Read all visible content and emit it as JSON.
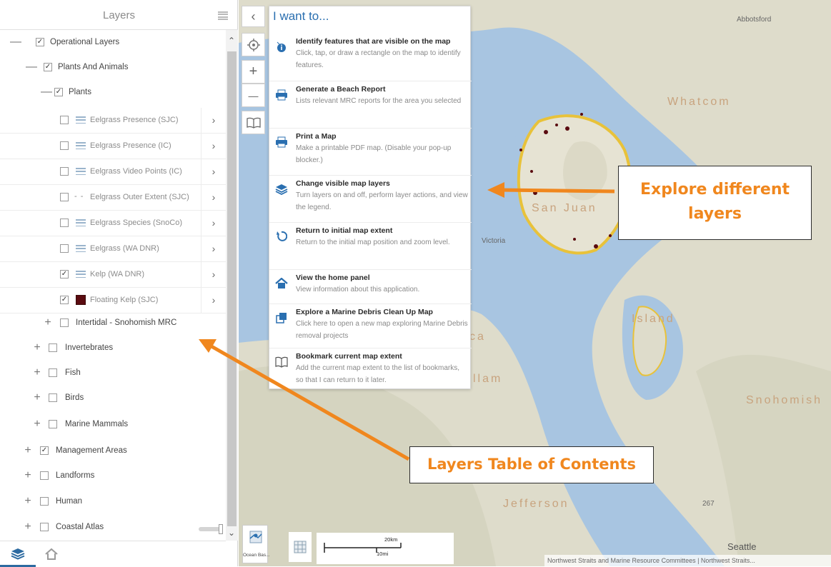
{
  "panel": {
    "title": "Layers",
    "rows": [
      {
        "label": "Operational Layers",
        "expander": "—",
        "checked": true
      },
      {
        "label": "Plants And Animals",
        "expander": "—",
        "checked": true
      },
      {
        "label": "Plants",
        "expander": "—",
        "checked": true
      },
      {
        "label": "Eelgrass Presence (SJC)",
        "checked": false,
        "legend": "lines"
      },
      {
        "label": "Eelgrass Presence (IC)",
        "checked": false,
        "legend": "lines"
      },
      {
        "label": "Eelgrass Video Points (IC)",
        "checked": false,
        "legend": "lines"
      },
      {
        "label": "Eelgrass Outer Extent (SJC)",
        "checked": false,
        "legend": "dash",
        "legend_text": "- -"
      },
      {
        "label": "Eelgrass Species (SnoCo)",
        "checked": false,
        "legend": "lines"
      },
      {
        "label": "Eelgrass (WA DNR)",
        "checked": false,
        "legend": "lines"
      },
      {
        "label": "Kelp (WA DNR)",
        "checked": true,
        "legend": "lines"
      },
      {
        "label": "Floating Kelp (SJC)",
        "checked": true,
        "legend": "swatch",
        "legend_color": "#5a0b10"
      },
      {
        "label": "Intertidal - Snohomish MRC",
        "expander": "+",
        "checked": false
      },
      {
        "label": "Invertebrates",
        "expander": "+",
        "checked": false
      },
      {
        "label": "Fish",
        "expander": "+",
        "checked": false
      },
      {
        "label": "Birds",
        "expander": "+",
        "checked": false
      },
      {
        "label": "Marine Mammals",
        "expander": "+",
        "checked": false
      },
      {
        "label": "Management Areas",
        "expander": "+",
        "checked": true
      },
      {
        "label": "Landforms",
        "expander": "+",
        "checked": false
      },
      {
        "label": "Human",
        "expander": "+",
        "checked": false
      },
      {
        "label": "Coastal Atlas",
        "expander": "+",
        "checked": false
      }
    ],
    "chevron": "›"
  },
  "iwant": {
    "title": "I want to...",
    "items": [
      {
        "icon": "info-icon",
        "title": "Identify features that are visible on the map",
        "desc": "Click, tap, or draw a rectangle on the map to identify features."
      },
      {
        "icon": "printer-icon",
        "title": "Generate a Beach Report",
        "desc": "Lists relevant MRC reports for the area you selected"
      },
      {
        "icon": "printer-icon",
        "title": "Print a Map",
        "desc": "Make a printable PDF map. (Disable your pop-up blocker.)"
      },
      {
        "icon": "layers-icon",
        "title": "Change visible map layers",
        "desc": "Turn layers on and off, perform layer actions, and view the legend."
      },
      {
        "icon": "return-icon",
        "title": "Return to initial map extent",
        "desc": "Return to the initial map position and zoom level."
      },
      {
        "icon": "home-icon",
        "title": "View the home panel",
        "desc": "View information about this application."
      },
      {
        "icon": "open-map-icon",
        "title": "Explore a Marine Debris Clean Up Map",
        "desc": "Click here to open a new map exploring Marine Debris removal projects"
      },
      {
        "icon": "book-icon",
        "title": "Bookmark current map extent",
        "desc": "Add the current map extent to the list of bookmarks, so that I can return to it later."
      }
    ]
  },
  "map": {
    "places": {
      "abbotsford": "Abbotsford",
      "whatcom": "Whatcom",
      "san_juan": "San Juan",
      "victoria": "Victoria",
      "island": "Island",
      "clallam": "llam",
      "ca": "ca",
      "snohomish": "Snohomish",
      "jefferson": "Jefferson",
      "seattle": "Seattle",
      "route": "267"
    },
    "collapse_arrow": "‹",
    "zoom_in": "+",
    "zoom_out": "—",
    "basemap_label": "Ocean Bas...",
    "scale_km": "20km",
    "scale_mi": "10mi",
    "attribution": "Northwest Straits and Marine Resource Committees | Northwest Straits..."
  },
  "callouts": {
    "layers_line1": "Explore different",
    "layers_line2": "layers",
    "toc": "Layers Table of Contents"
  },
  "colors": {
    "accent_blue": "#2a6fb0",
    "callout_orange": "#f0871e",
    "water": "#a9c6e3",
    "land": "#dcdcc9"
  }
}
